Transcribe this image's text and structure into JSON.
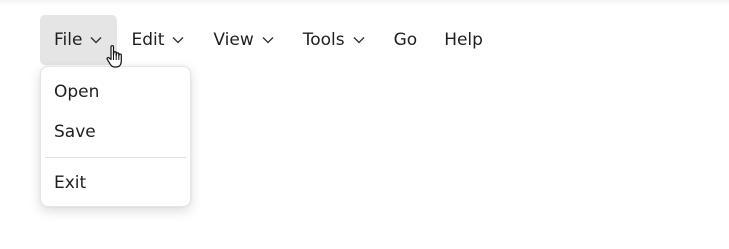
{
  "menubar": {
    "items": [
      {
        "label": "File",
        "has_chevron": true,
        "active": true
      },
      {
        "label": "Edit",
        "has_chevron": true,
        "active": false
      },
      {
        "label": "View",
        "has_chevron": true,
        "active": false
      },
      {
        "label": "Tools",
        "has_chevron": true,
        "active": false
      },
      {
        "label": "Go",
        "has_chevron": false,
        "active": false
      },
      {
        "label": "Help",
        "has_chevron": false,
        "active": false
      }
    ]
  },
  "file_menu": {
    "items": [
      {
        "label": "Open"
      },
      {
        "label": "Save"
      },
      {
        "label": "Exit"
      }
    ]
  },
  "icons": {
    "chevron": "chevron-down-icon",
    "cursor": "hand-pointer-icon"
  },
  "colors": {
    "active_menu_bg": "#e5e5e5",
    "text": "#1f1f1f"
  }
}
